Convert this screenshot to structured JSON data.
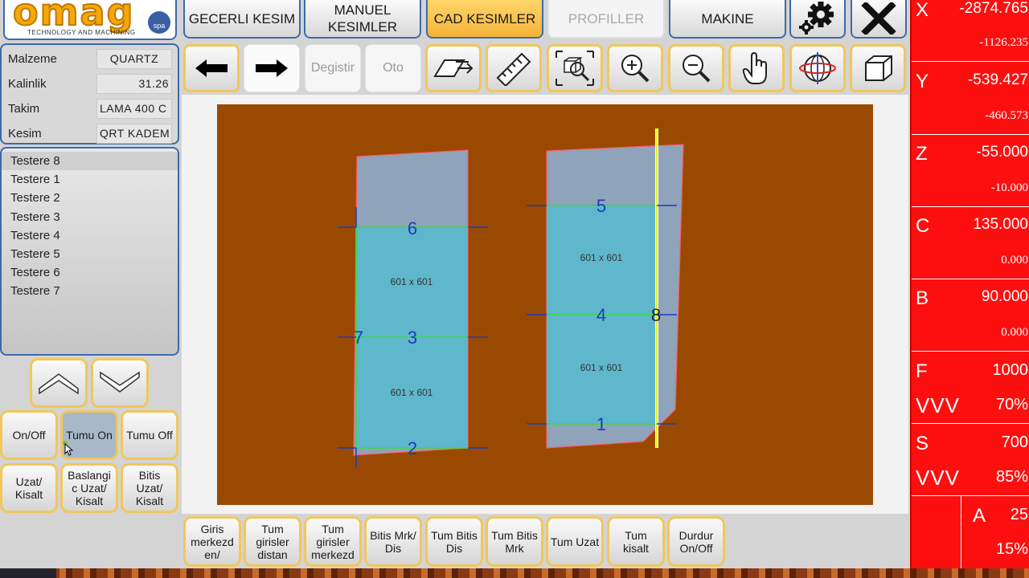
{
  "logo": {
    "word": "omag",
    "spa": "spa",
    "tagline": "TECHNOLOGY AND MACHINING"
  },
  "tabs": [
    {
      "label": "GECERLI KESIM"
    },
    {
      "label": "MANUEL\nKESIMLER"
    },
    {
      "label": "CAD KESIMLER"
    },
    {
      "label": "PROFILLER"
    },
    {
      "label": "MAKINE"
    }
  ],
  "top_icons": [
    "gear-icon",
    "close-icon"
  ],
  "toolbar": {
    "back_icon": "arrow-left-icon",
    "forward_icon": "arrow-right-icon",
    "degistir_label": "Degistir",
    "oto_label": "Oto",
    "icons": [
      "eraser-icon",
      "ruler-icon",
      "zoom-fit-icon",
      "zoom-in-icon",
      "zoom-out-icon",
      "hand-pointer-icon",
      "globe-rotate-icon",
      "cube-3d-icon"
    ]
  },
  "info": {
    "rows": [
      {
        "label": "Malzeme",
        "value": "QUARTZ"
      },
      {
        "label": "Kalinlik",
        "value": "31.26"
      },
      {
        "label": "Takim",
        "value": "LAMA 400 C"
      },
      {
        "label": "Kesim",
        "value": "QRT KADEM"
      }
    ]
  },
  "list": {
    "items": [
      "Testere 8",
      "Testere 1",
      "Testere 2",
      "Testere 3",
      "Testere 4",
      "Testere 5",
      "Testere 6",
      "Testere 7"
    ]
  },
  "left_buttons": {
    "up_icon": "chevron-up-icon",
    "down_icon": "chevron-down-icon",
    "on_off": "On/Off",
    "tumu_on": "Tumu On",
    "tumu_off": "Tumu Off",
    "uzat_kisalt": "Uzat/\nKisalt",
    "baslangic": "Baslangi\nc Uzat/\nKisalt",
    "bitis": "Bitis\nUzat/\nKisalt"
  },
  "drawing": {
    "left_slab": {
      "piece_top": "601 x 601",
      "piece_bottom": "601 x 601",
      "cut_numbers": [
        "6",
        "7",
        "3",
        "2"
      ]
    },
    "right_slab": {
      "piece_top": "601 x 601",
      "piece_bottom": "601 x 601",
      "cut_numbers": [
        "5",
        "8",
        "4",
        "1"
      ]
    }
  },
  "bottom_buttons": [
    "Giris\nmerkezd\nen/",
    "Tum\ngirisler\ndistan",
    "Tum\ngirisler\nmerkezd",
    "Bitis Mrk/\nDis",
    "Tum Bitis\nDis",
    "Tum Bitis\nMrk",
    "Tum Uzat",
    "Tum\nkisalt",
    "Durdur\nOn/Off"
  ],
  "axes": [
    {
      "name": "X",
      "value": "-2874.765",
      "secondary": "-1126.235"
    },
    {
      "name": "Y",
      "value": "-539.427",
      "secondary": "-460.573"
    },
    {
      "name": "Z",
      "value": "-55.000",
      "secondary": "-10.000"
    },
    {
      "name": "C",
      "value": "135.000",
      "secondary": "0.000"
    },
    {
      "name": "B",
      "value": "90.000",
      "secondary": "0.000"
    }
  ],
  "feed": {
    "f_name": "F",
    "f_value": "1000",
    "vvv1": "VVV",
    "vvv1_pct": "70%"
  },
  "speed": {
    "s_name": "S",
    "s_value": "700",
    "vvv2": "VVV",
    "vvv2_pct": "85%"
  },
  "extra": {
    "a_name": "A",
    "a_value": "25",
    "a_pct": "15%"
  },
  "colors": {
    "accent": "#f2c75a",
    "border_blue": "#3d6aa8",
    "panel_red": "#fe0f0f",
    "slab_brown": "#9a4a00",
    "piece_cyan": "#5fb7cc"
  }
}
